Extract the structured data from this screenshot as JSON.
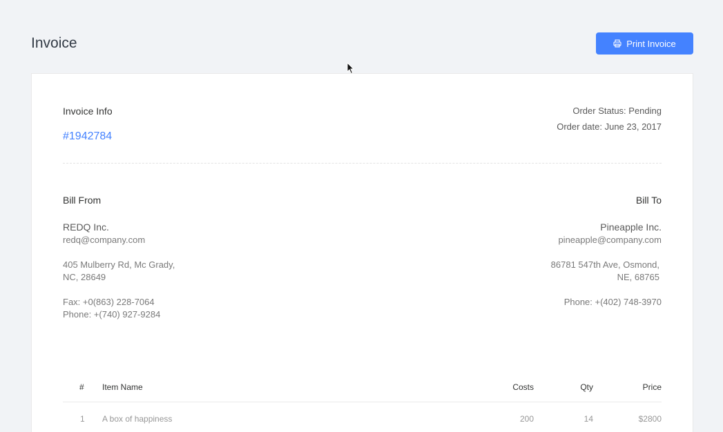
{
  "header": {
    "title": "Invoice",
    "print_label": "Print Invoice"
  },
  "invoice_info": {
    "heading": "Invoice Info",
    "number": "#1942784",
    "order_status": "Order Status: Pending",
    "order_date": "Order date: June 23, 2017"
  },
  "bill_from": {
    "heading": "Bill From",
    "company": "REDQ Inc.",
    "email": "redq@company.com",
    "address_line1": "405 Mulberry Rd, Mc Grady,",
    "address_line2": "NC, 28649",
    "fax": "Fax: +0(863) 228-7064",
    "phone": "Phone: +(740) 927-9284"
  },
  "bill_to": {
    "heading": "Bill To",
    "company": "Pineapple Inc.",
    "email": "pineapple@company.com",
    "address_line1": "86781 547th Ave, Osmond,",
    "address_line2": "NE, 68765",
    "phone": "Phone: +(402) 748-3970"
  },
  "table": {
    "columns": [
      "#",
      "Item Name",
      "Costs",
      "Qty",
      "Price"
    ],
    "rows": [
      [
        "1",
        "A box of happiness",
        "200",
        "14",
        "$2800"
      ]
    ]
  },
  "colors": {
    "accent": "#4482ff",
    "background": "#f1f3f6"
  },
  "icons": {
    "print": "printer-icon",
    "cursor": "mouse-pointer-icon"
  }
}
